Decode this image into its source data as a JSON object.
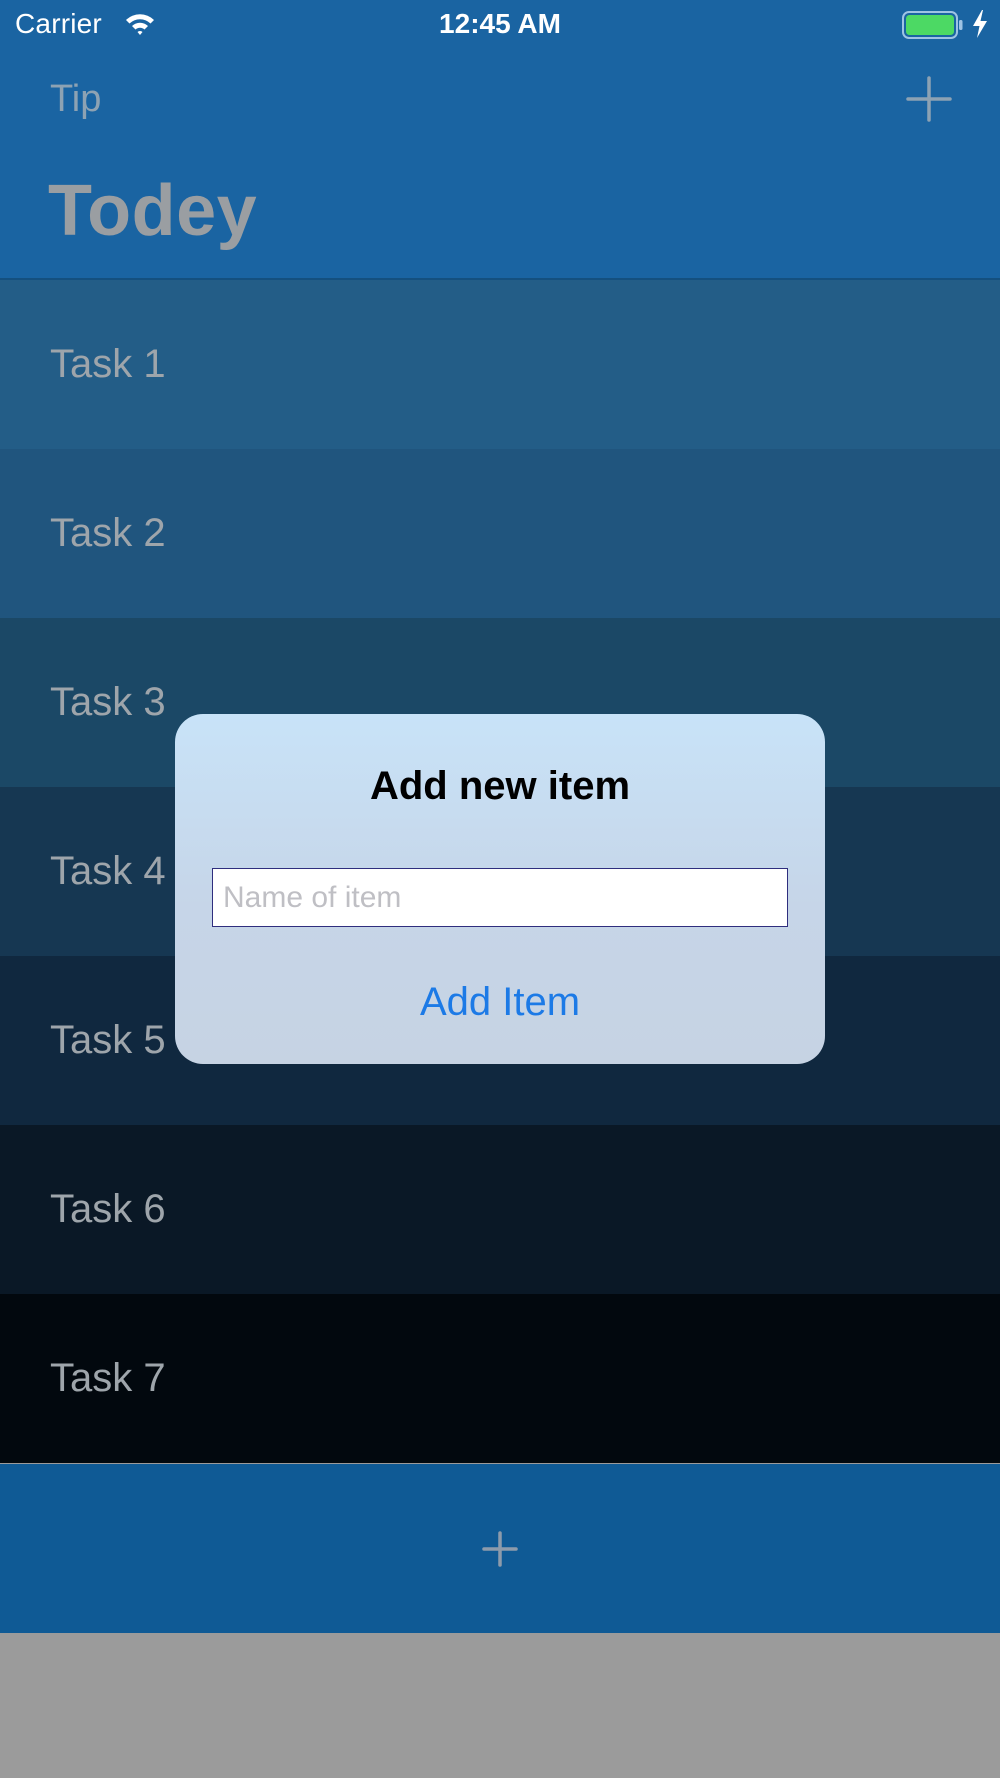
{
  "status_bar": {
    "carrier": "Carrier",
    "time": "12:45 AM",
    "wifi_icon": "wifi-icon",
    "battery_icon": "battery-charging-icon",
    "battery_level": 1.0
  },
  "nav_bar": {
    "left_item": "Tip",
    "right_icon": "plus-icon",
    "large_title": "Todey"
  },
  "tasks": [
    {
      "label": "Task 1",
      "color": "#235d87"
    },
    {
      "label": "Task 2",
      "color": "#20557e"
    },
    {
      "label": "Task 3",
      "color": "#1b4866"
    },
    {
      "label": "Task 4",
      "color": "#163752"
    },
    {
      "label": "Task 5",
      "color": "#10283f"
    },
    {
      "label": "Task 6",
      "color": "#0a1826"
    },
    {
      "label": "Task 7",
      "color": "#02080e"
    }
  ],
  "bottom_bar": {
    "icon": "plus-icon",
    "color": "#0f5a95"
  },
  "alert": {
    "title": "Add new item",
    "input_placeholder": "Name of item",
    "input_value": "",
    "action_label": "Add Item"
  },
  "colors": {
    "nav_background": "#1a64a2",
    "action_blue": "#1c7ae6",
    "dim_background": "#9b9b9b"
  }
}
